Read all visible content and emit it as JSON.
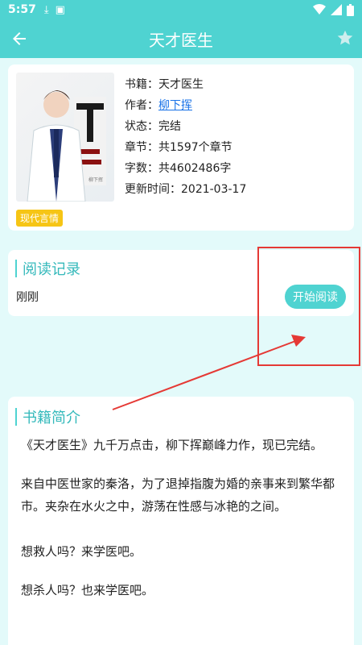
{
  "statusbar": {
    "time": "5:57"
  },
  "appbar": {
    "title": "天才医生"
  },
  "book": {
    "name_line": "书籍：天才医生",
    "author_label": "作者：",
    "author": "柳下挥",
    "status_line": "状态：完结",
    "chapters_line": "章节：共1597个章节",
    "words_line": "字数：共4602486字",
    "updated_line": "更新时间：2021-03-17",
    "tag": "现代言情"
  },
  "record": {
    "title": "阅读记录",
    "last_read": "刚刚",
    "start_button": "开始阅读"
  },
  "intro": {
    "title": "书籍简介",
    "paragraphs": [
      "《天才医生》九千万点击，柳下挥巅峰力作，现已完结。",
      "来自中医世家的秦洛，为了退掉指腹为婚的亲事来到繁华都市。夹杂在水火之中，游荡在性感与冰艳的之间。",
      "想救人吗？来学医吧。",
      "想杀人吗？也来学医吧。"
    ]
  },
  "colors": {
    "accent": "#4fd3d1",
    "tag": "#f6c515",
    "annotation": "#e53935"
  }
}
